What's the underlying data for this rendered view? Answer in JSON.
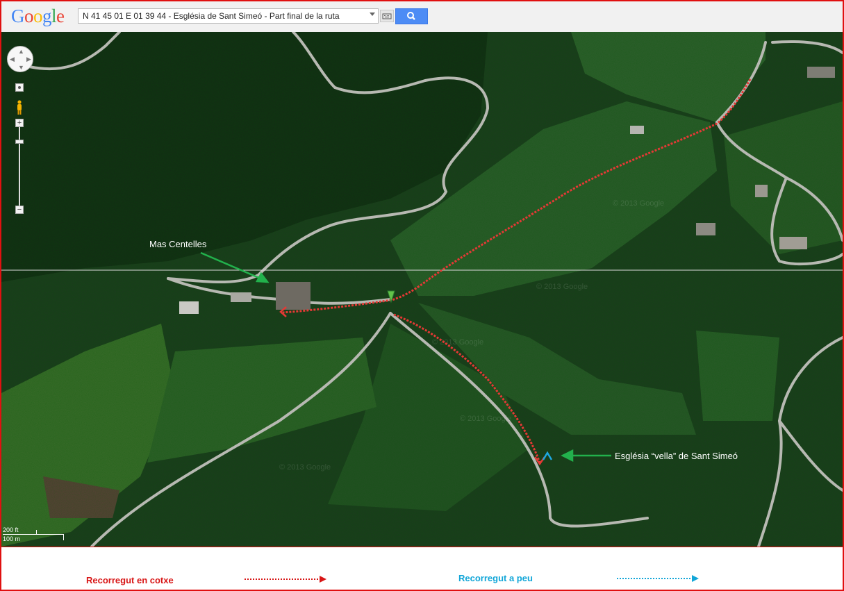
{
  "logo": {
    "text": "Google",
    "letters": [
      {
        "ch": "G",
        "color": "#4285f4"
      },
      {
        "ch": "o",
        "color": "#ea4335"
      },
      {
        "ch": "o",
        "color": "#fbbc05"
      },
      {
        "ch": "g",
        "color": "#4285f4"
      },
      {
        "ch": "l",
        "color": "#34a853"
      },
      {
        "ch": "e",
        "color": "#ea4335"
      }
    ]
  },
  "search": {
    "query": "N 41 45 01 E 01 39 44 - Església de Sant Simeó - Part final de la ruta",
    "dropdown_icon": "triangle-down-icon",
    "keyboard_icon": "keyboard-icon",
    "button_icon": "search-icon",
    "button_color": "#4d8cf5"
  },
  "map_controls": {
    "pan_icon": "pan-compass-icon",
    "pegman_icon": "pegman-icon",
    "zoom_in": "+",
    "zoom_out": "−"
  },
  "scale_bar": {
    "imperial": "200 ft",
    "metric": "100 m"
  },
  "annotations": {
    "mas_centelles": "Mas Centelles",
    "esglesia": "Església “vella” de Sant Simeó"
  },
  "legend": {
    "car_label": "Recorregut en cotxe",
    "car_color": "#d81616",
    "walk_label": "Recorregut a peu",
    "walk_color": "#12a6d8"
  },
  "colors": {
    "frame": "#e01010",
    "arrow_annotation": "#22b14c",
    "route": "#e53935"
  }
}
